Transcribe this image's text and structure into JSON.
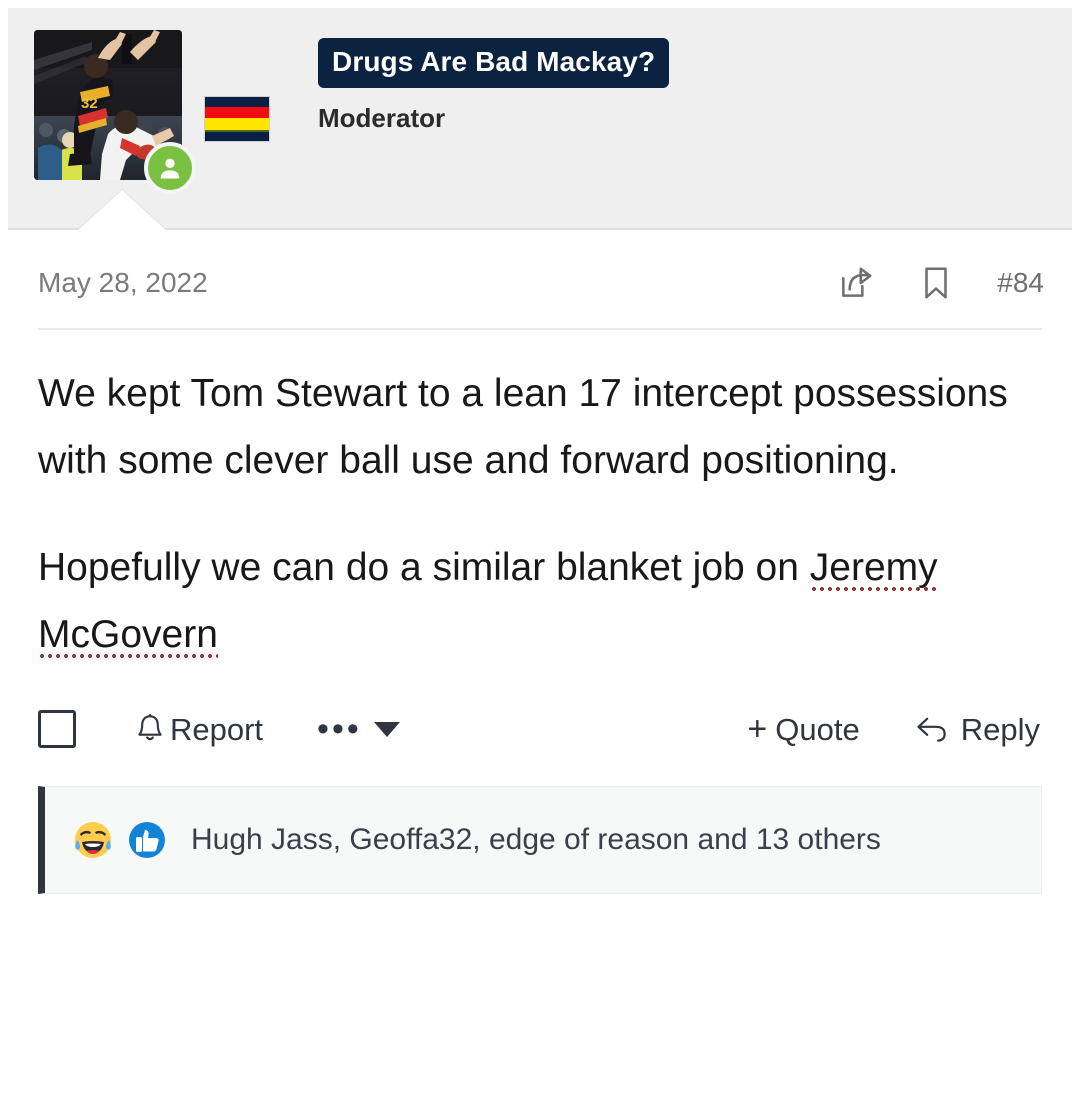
{
  "post": {
    "author": {
      "username": "Drugs Are Bad Mackay?",
      "title": "Moderator",
      "online_status": "online",
      "avatar_description": "afl-player-marking-photo",
      "flag_badge": "adelaide-crows-flag",
      "badge_bg_color": "#0b2240",
      "badge_text_color": "#ffffff",
      "online_color": "#7ac142"
    },
    "meta": {
      "date": "May 28, 2022",
      "post_number": "#84",
      "share_icon": "share-icon",
      "bookmark_icon": "bookmark-icon"
    },
    "content": {
      "paragraph_1": "We kept Tom Stewart to a lean 17 intercept possessions with some clever ball use and forward positioning.",
      "paragraph_2_prefix": "Hopefully we can do a similar blanket job on ",
      "paragraph_2_misspelled": "Jeremy McGovern",
      "spellcheck_color": "#8b3a3a"
    },
    "actions": {
      "select_checkbox": "",
      "report_label": "Report",
      "report_icon": "bell-icon",
      "more_label": "•••",
      "more_icon": "chevron-down-icon",
      "quote_plus": "+",
      "quote_label": "Quote",
      "reply_icon": "reply-arrow-icon",
      "reply_label": "Reply"
    },
    "reactions": {
      "emoji_1": "rofl-emoji",
      "emoji_2": "thumbs-up-emoji",
      "summary": "Hugh Jass, Geoffa32, edge of reason and 13 others",
      "accent_color": "#31353f"
    }
  }
}
